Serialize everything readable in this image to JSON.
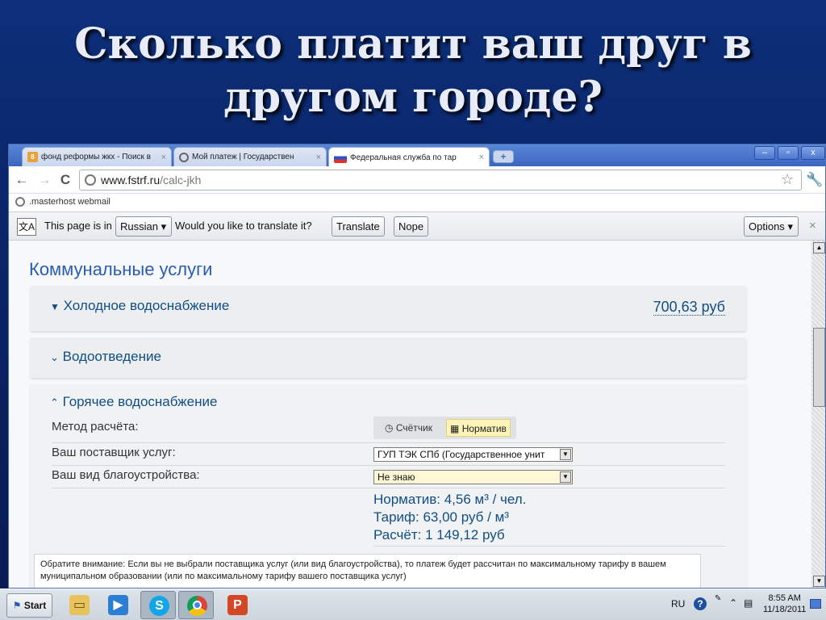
{
  "slide": {
    "title": "Сколько платит ваш друг в другом городе?"
  },
  "browser": {
    "tabs": [
      {
        "label": "фонд реформы жкх - Поиск в",
        "icon": "google-icon"
      },
      {
        "label": "Мой платеж | Государствен",
        "icon": "globe-icon"
      },
      {
        "label": "Федеральная служба по тар",
        "icon": "fst-icon",
        "favicon_text": "ФСТ"
      }
    ],
    "tab_close": "×",
    "new_tab": "+",
    "window_controls": {
      "minimize": "–",
      "maximize": "▫",
      "close": "x"
    },
    "address": {
      "host": "www.fstrf.ru",
      "path": "/calc-jkh"
    },
    "bookmark": ".masterhost webmail",
    "translate_bar": {
      "prefix": "This page is in",
      "language": "Russian",
      "question": "Would you like to translate it?",
      "translate": "Translate",
      "nope": "Nope",
      "options": "Options"
    }
  },
  "page": {
    "section_title": "Коммунальные услуги",
    "cold_water": {
      "title": "Холодное водоснабжение",
      "amount": "700,63 руб"
    },
    "drainage": {
      "title": "Водоотведение"
    },
    "hot_water": {
      "title": "Горячее водоснабжение",
      "method_label": "Метод расчёта:",
      "method_options": [
        "Счётчик",
        "Норматив"
      ],
      "method_selected": "Норматив",
      "provider_label": "Ваш поставщик услуг:",
      "provider_value": "ГУП ТЭК СПб (Государственное унит",
      "improvement_label": "Ваш вид благоустройства:",
      "improvement_value": "Не знаю",
      "norm": "Норматив: 4,56 м³ / чел.",
      "tariff": "Тариф: 63,00 руб / м³",
      "calc": "Расчёт: 1 149,12 руб"
    },
    "notice": "Обратите внимание: Если вы не выбрали поставщика услуг (или вид благоустройства), то платеж будет рассчитан по максимальному тарифу в вашем муниципальном образовании (или по максимальному тарифу вашего поставщика услуг)"
  },
  "taskbar": {
    "start": "Start",
    "lang": "RU",
    "time": "8:55 AM",
    "date": "11/18/2011"
  }
}
